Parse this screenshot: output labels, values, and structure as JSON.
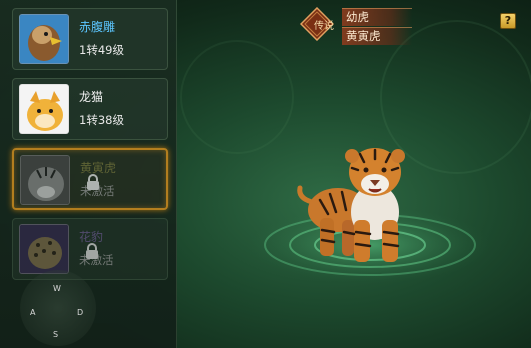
{
  "title": {
    "rarity_badge": "传说",
    "stage": "幼虎",
    "name": "黄寅虎"
  },
  "help_label": "?",
  "pets": [
    {
      "name": "赤腹雕",
      "level": "1转49级",
      "state": "owned"
    },
    {
      "name": "龙猫",
      "level": "1转38级",
      "state": "owned"
    },
    {
      "name": "黄寅虎",
      "level": "未激活",
      "state": "locked-selected"
    },
    {
      "name": "花豹",
      "level": "未激活",
      "state": "locked"
    }
  ],
  "joystick": {
    "up": "W",
    "left": "A",
    "right": "D",
    "down": "S"
  },
  "colors": {
    "selected_border": "#f0a020",
    "rarity_banner": "#8c3c1e",
    "stage_bg": "#1d4a2e"
  }
}
